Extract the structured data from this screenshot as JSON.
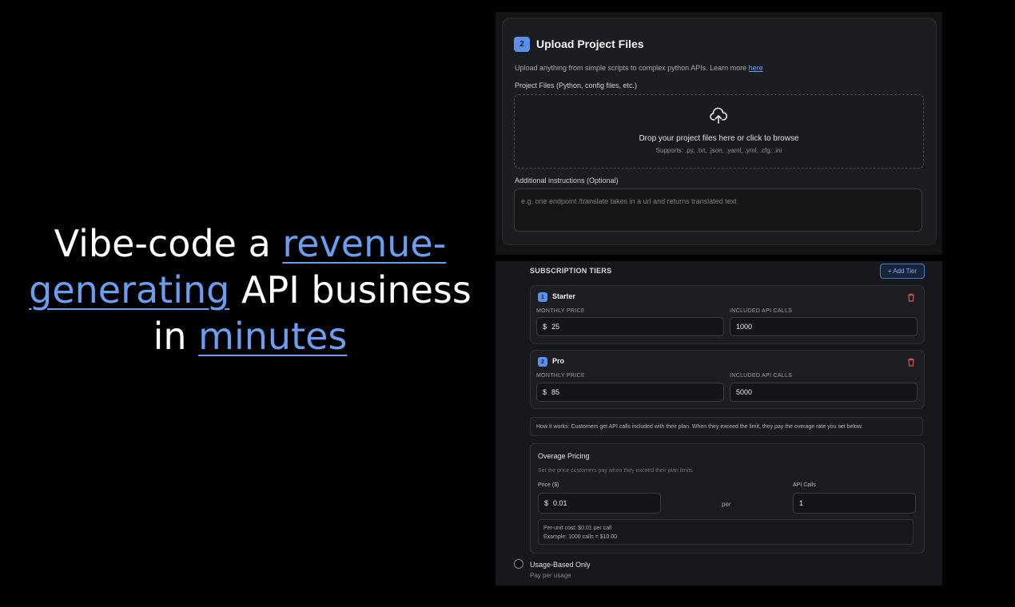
{
  "headline": {
    "part1": "Vibe-code a ",
    "highlight1": "revenue-generating",
    "part2": " API business in ",
    "highlight2": "minutes"
  },
  "upload": {
    "step": "2",
    "title": "Upload Project Files",
    "description": "Upload anything from simple scripts to complex python APIs. Learn more ",
    "link": "here",
    "files_label": "Project Files (Python, config files, etc.)",
    "drop_text": "Drop your project files here or click to browse",
    "supports": "Supports: .py, .txt, .json, .yaml, .yml, .cfg, .ini",
    "instructions_label": "Additional instructions (Optional)",
    "instructions_placeholder": "e.g. one endpoint /translate takes in a url and returns translated text"
  },
  "tiers": {
    "section_title": "SUBSCRIPTION TIERS",
    "add_tier": "+ Add Tier",
    "price_label": "MONTHLY PRICE",
    "calls_label": "INCLUDED API CALLS",
    "currency": "$",
    "items": [
      {
        "num": "1",
        "name": "Starter",
        "price": "25",
        "calls": "1000"
      },
      {
        "num": "2",
        "name": "Pro",
        "price": "85",
        "calls": "5000"
      }
    ],
    "info": "How it works: Customers get API calls included with their plan. When they exceed the limit, they pay the overage rate you set below."
  },
  "overage": {
    "title": "Overage Pricing",
    "subtitle": "Set the price customers pay when they exceed their plan limits",
    "price_label": "Price ($)",
    "calls_label": "API Calls",
    "currency": "$",
    "price": "0.01",
    "per": "per",
    "calls": "1",
    "unit_cost": "Per-unit cost: $0.01 per call",
    "example": "Example: 1000 calls = $10.00"
  },
  "usage_option": {
    "label": "Usage-Based Only",
    "sub": "Pay per usage"
  },
  "colors": {
    "accent": "#6a9eef",
    "badge": "#5b90e6",
    "background": "#000000"
  }
}
